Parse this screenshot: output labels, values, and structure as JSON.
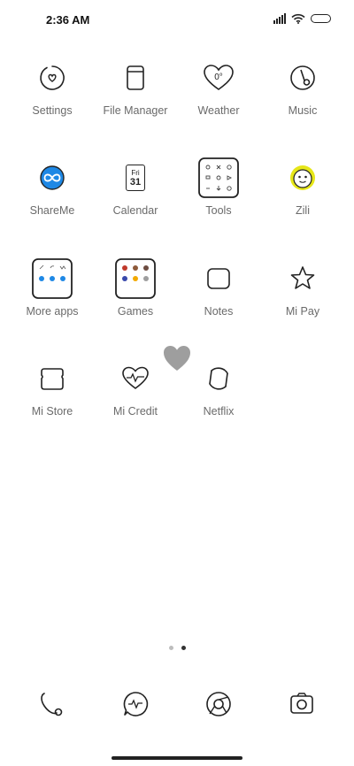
{
  "status_bar": {
    "time": "2:36 AM",
    "icons": [
      "signal-icon",
      "wifi-icon",
      "battery-icon"
    ]
  },
  "apps": [
    {
      "id": "settings",
      "label": "Settings",
      "icon": "settings-icon"
    },
    {
      "id": "file-manager",
      "label": "File Manager",
      "icon": "file-manager-icon"
    },
    {
      "id": "weather",
      "label": "Weather",
      "icon": "weather-icon"
    },
    {
      "id": "music",
      "label": "Music",
      "icon": "music-icon"
    },
    {
      "id": "shareme",
      "label": "ShareMe",
      "icon": "shareme-icon"
    },
    {
      "id": "calendar",
      "label": "Calendar",
      "icon": "calendar-icon",
      "day_name": "Fri",
      "day_number": "31"
    },
    {
      "id": "tools",
      "label": "Tools",
      "icon": "tools-folder-icon"
    },
    {
      "id": "zili",
      "label": "Zili",
      "icon": "zili-icon"
    },
    {
      "id": "more-apps",
      "label": "More apps",
      "icon": "more-apps-folder-icon"
    },
    {
      "id": "games",
      "label": "Games",
      "icon": "games-folder-icon"
    },
    {
      "id": "notes",
      "label": "Notes",
      "icon": "notes-icon"
    },
    {
      "id": "mi-pay",
      "label": "Mi Pay",
      "icon": "mi-pay-icon"
    },
    {
      "id": "mi-store",
      "label": "Mi Store",
      "icon": "mi-store-icon"
    },
    {
      "id": "mi-credit",
      "label": "Mi Credit",
      "icon": "mi-credit-icon"
    },
    {
      "id": "netflix",
      "label": "Netflix",
      "icon": "netflix-icon"
    }
  ],
  "page_indicator": {
    "pages": 2,
    "current": 2
  },
  "dock": [
    {
      "id": "phone",
      "icon": "phone-icon"
    },
    {
      "id": "messages",
      "icon": "messages-icon"
    },
    {
      "id": "browser",
      "icon": "browser-icon"
    },
    {
      "id": "camera",
      "icon": "camera-icon"
    }
  ],
  "colors": {
    "background": "#ffffff",
    "label": "#6a6a6a",
    "stroke": "#222222",
    "shareme_blue": "#1e88e5",
    "zili_yellow": "#e6e619",
    "floating_heart": "#9e9e9e"
  }
}
